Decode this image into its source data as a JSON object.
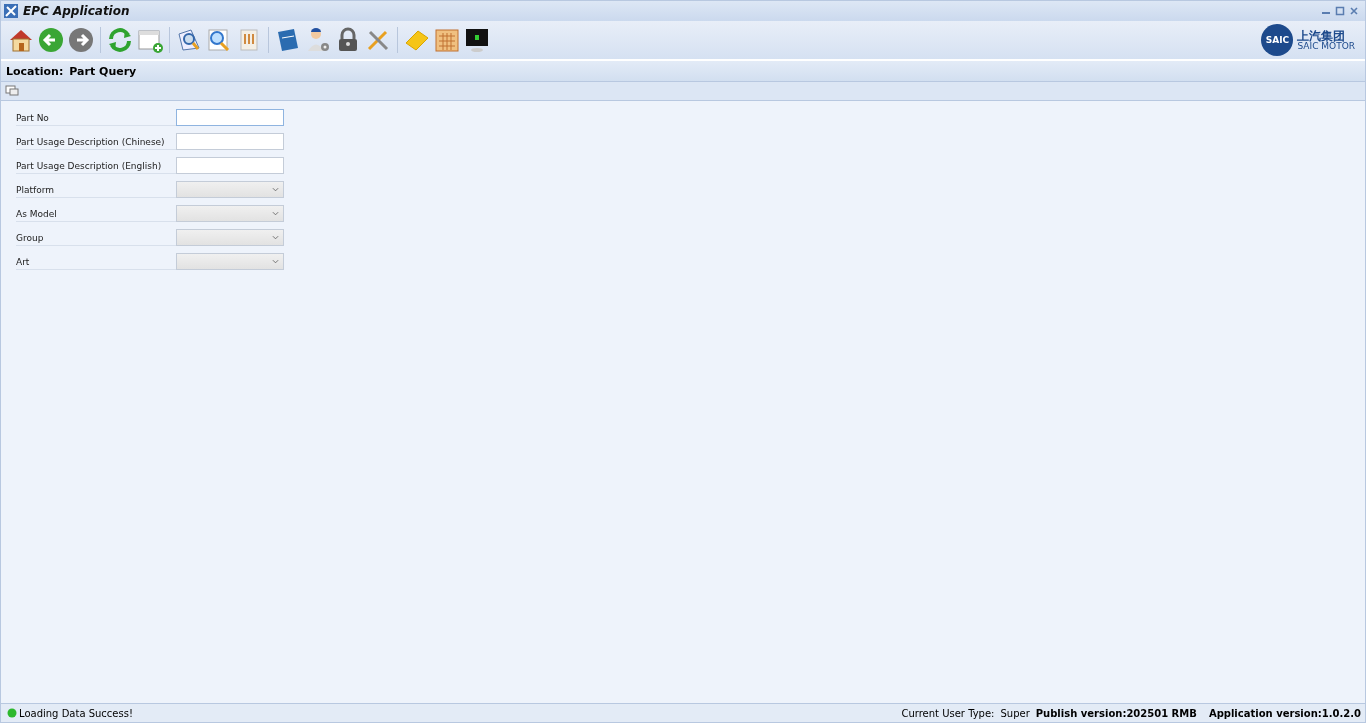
{
  "window": {
    "title": "EPC Application"
  },
  "logo": {
    "badge": "SAIC",
    "chinese": "上汽集团",
    "english": "SAIC MOTOR"
  },
  "location": {
    "label": "Location:",
    "value": "Part Query"
  },
  "form": {
    "fields": [
      {
        "label": "Part No",
        "kind": "text",
        "focused": true
      },
      {
        "label": "Part Usage Description  (Chinese)",
        "kind": "text",
        "focused": false
      },
      {
        "label": "Part Usage Description  (English)",
        "kind": "text",
        "focused": false
      },
      {
        "label": "Platform",
        "kind": "select",
        "focused": false
      },
      {
        "label": "As Model",
        "kind": "select",
        "focused": false
      },
      {
        "label": "Group",
        "kind": "select",
        "focused": false
      },
      {
        "label": "Art",
        "kind": "select",
        "focused": false
      }
    ]
  },
  "status_bar": {
    "message": "Loading Data Success!",
    "user_type_label": "Current User Type:",
    "user_type": "Super",
    "publish_version": "Publish version:202501 RMB",
    "app_version": "Application version:1.0.2.0"
  }
}
